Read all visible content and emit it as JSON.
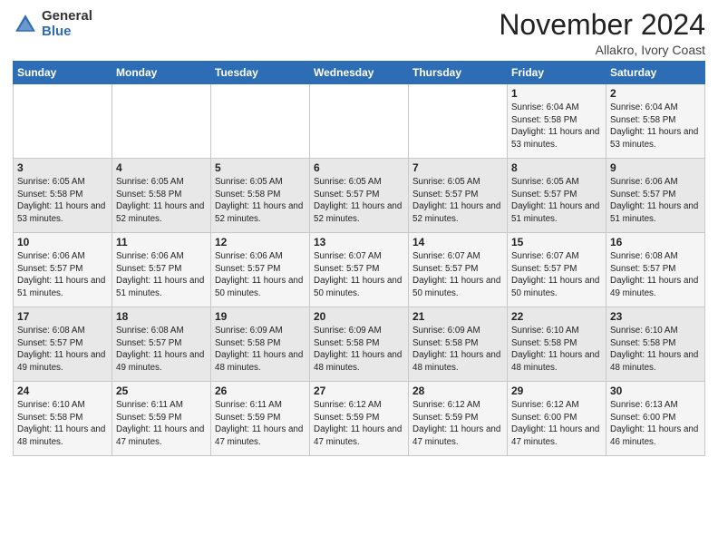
{
  "header": {
    "logo_general": "General",
    "logo_blue": "Blue",
    "month_title": "November 2024",
    "location": "Allakro, Ivory Coast"
  },
  "days_of_week": [
    "Sunday",
    "Monday",
    "Tuesday",
    "Wednesday",
    "Thursday",
    "Friday",
    "Saturday"
  ],
  "weeks": [
    [
      {
        "day": "",
        "info": ""
      },
      {
        "day": "",
        "info": ""
      },
      {
        "day": "",
        "info": ""
      },
      {
        "day": "",
        "info": ""
      },
      {
        "day": "",
        "info": ""
      },
      {
        "day": "1",
        "info": "Sunrise: 6:04 AM\nSunset: 5:58 PM\nDaylight: 11 hours\nand 53 minutes."
      },
      {
        "day": "2",
        "info": "Sunrise: 6:04 AM\nSunset: 5:58 PM\nDaylight: 11 hours\nand 53 minutes."
      }
    ],
    [
      {
        "day": "3",
        "info": "Sunrise: 6:05 AM\nSunset: 5:58 PM\nDaylight: 11 hours\nand 53 minutes."
      },
      {
        "day": "4",
        "info": "Sunrise: 6:05 AM\nSunset: 5:58 PM\nDaylight: 11 hours\nand 52 minutes."
      },
      {
        "day": "5",
        "info": "Sunrise: 6:05 AM\nSunset: 5:58 PM\nDaylight: 11 hours\nand 52 minutes."
      },
      {
        "day": "6",
        "info": "Sunrise: 6:05 AM\nSunset: 5:57 PM\nDaylight: 11 hours\nand 52 minutes."
      },
      {
        "day": "7",
        "info": "Sunrise: 6:05 AM\nSunset: 5:57 PM\nDaylight: 11 hours\nand 52 minutes."
      },
      {
        "day": "8",
        "info": "Sunrise: 6:05 AM\nSunset: 5:57 PM\nDaylight: 11 hours\nand 51 minutes."
      },
      {
        "day": "9",
        "info": "Sunrise: 6:06 AM\nSunset: 5:57 PM\nDaylight: 11 hours\nand 51 minutes."
      }
    ],
    [
      {
        "day": "10",
        "info": "Sunrise: 6:06 AM\nSunset: 5:57 PM\nDaylight: 11 hours\nand 51 minutes."
      },
      {
        "day": "11",
        "info": "Sunrise: 6:06 AM\nSunset: 5:57 PM\nDaylight: 11 hours\nand 51 minutes."
      },
      {
        "day": "12",
        "info": "Sunrise: 6:06 AM\nSunset: 5:57 PM\nDaylight: 11 hours\nand 50 minutes."
      },
      {
        "day": "13",
        "info": "Sunrise: 6:07 AM\nSunset: 5:57 PM\nDaylight: 11 hours\nand 50 minutes."
      },
      {
        "day": "14",
        "info": "Sunrise: 6:07 AM\nSunset: 5:57 PM\nDaylight: 11 hours\nand 50 minutes."
      },
      {
        "day": "15",
        "info": "Sunrise: 6:07 AM\nSunset: 5:57 PM\nDaylight: 11 hours\nand 50 minutes."
      },
      {
        "day": "16",
        "info": "Sunrise: 6:08 AM\nSunset: 5:57 PM\nDaylight: 11 hours\nand 49 minutes."
      }
    ],
    [
      {
        "day": "17",
        "info": "Sunrise: 6:08 AM\nSunset: 5:57 PM\nDaylight: 11 hours\nand 49 minutes."
      },
      {
        "day": "18",
        "info": "Sunrise: 6:08 AM\nSunset: 5:57 PM\nDaylight: 11 hours\nand 49 minutes."
      },
      {
        "day": "19",
        "info": "Sunrise: 6:09 AM\nSunset: 5:58 PM\nDaylight: 11 hours\nand 48 minutes."
      },
      {
        "day": "20",
        "info": "Sunrise: 6:09 AM\nSunset: 5:58 PM\nDaylight: 11 hours\nand 48 minutes."
      },
      {
        "day": "21",
        "info": "Sunrise: 6:09 AM\nSunset: 5:58 PM\nDaylight: 11 hours\nand 48 minutes."
      },
      {
        "day": "22",
        "info": "Sunrise: 6:10 AM\nSunset: 5:58 PM\nDaylight: 11 hours\nand 48 minutes."
      },
      {
        "day": "23",
        "info": "Sunrise: 6:10 AM\nSunset: 5:58 PM\nDaylight: 11 hours\nand 48 minutes."
      }
    ],
    [
      {
        "day": "24",
        "info": "Sunrise: 6:10 AM\nSunset: 5:58 PM\nDaylight: 11 hours\nand 48 minutes."
      },
      {
        "day": "25",
        "info": "Sunrise: 6:11 AM\nSunset: 5:59 PM\nDaylight: 11 hours\nand 47 minutes."
      },
      {
        "day": "26",
        "info": "Sunrise: 6:11 AM\nSunset: 5:59 PM\nDaylight: 11 hours\nand 47 minutes."
      },
      {
        "day": "27",
        "info": "Sunrise: 6:12 AM\nSunset: 5:59 PM\nDaylight: 11 hours\nand 47 minutes."
      },
      {
        "day": "28",
        "info": "Sunrise: 6:12 AM\nSunset: 5:59 PM\nDaylight: 11 hours\nand 47 minutes."
      },
      {
        "day": "29",
        "info": "Sunrise: 6:12 AM\nSunset: 6:00 PM\nDaylight: 11 hours\nand 47 minutes."
      },
      {
        "day": "30",
        "info": "Sunrise: 6:13 AM\nSunset: 6:00 PM\nDaylight: 11 hours\nand 46 minutes."
      }
    ]
  ]
}
